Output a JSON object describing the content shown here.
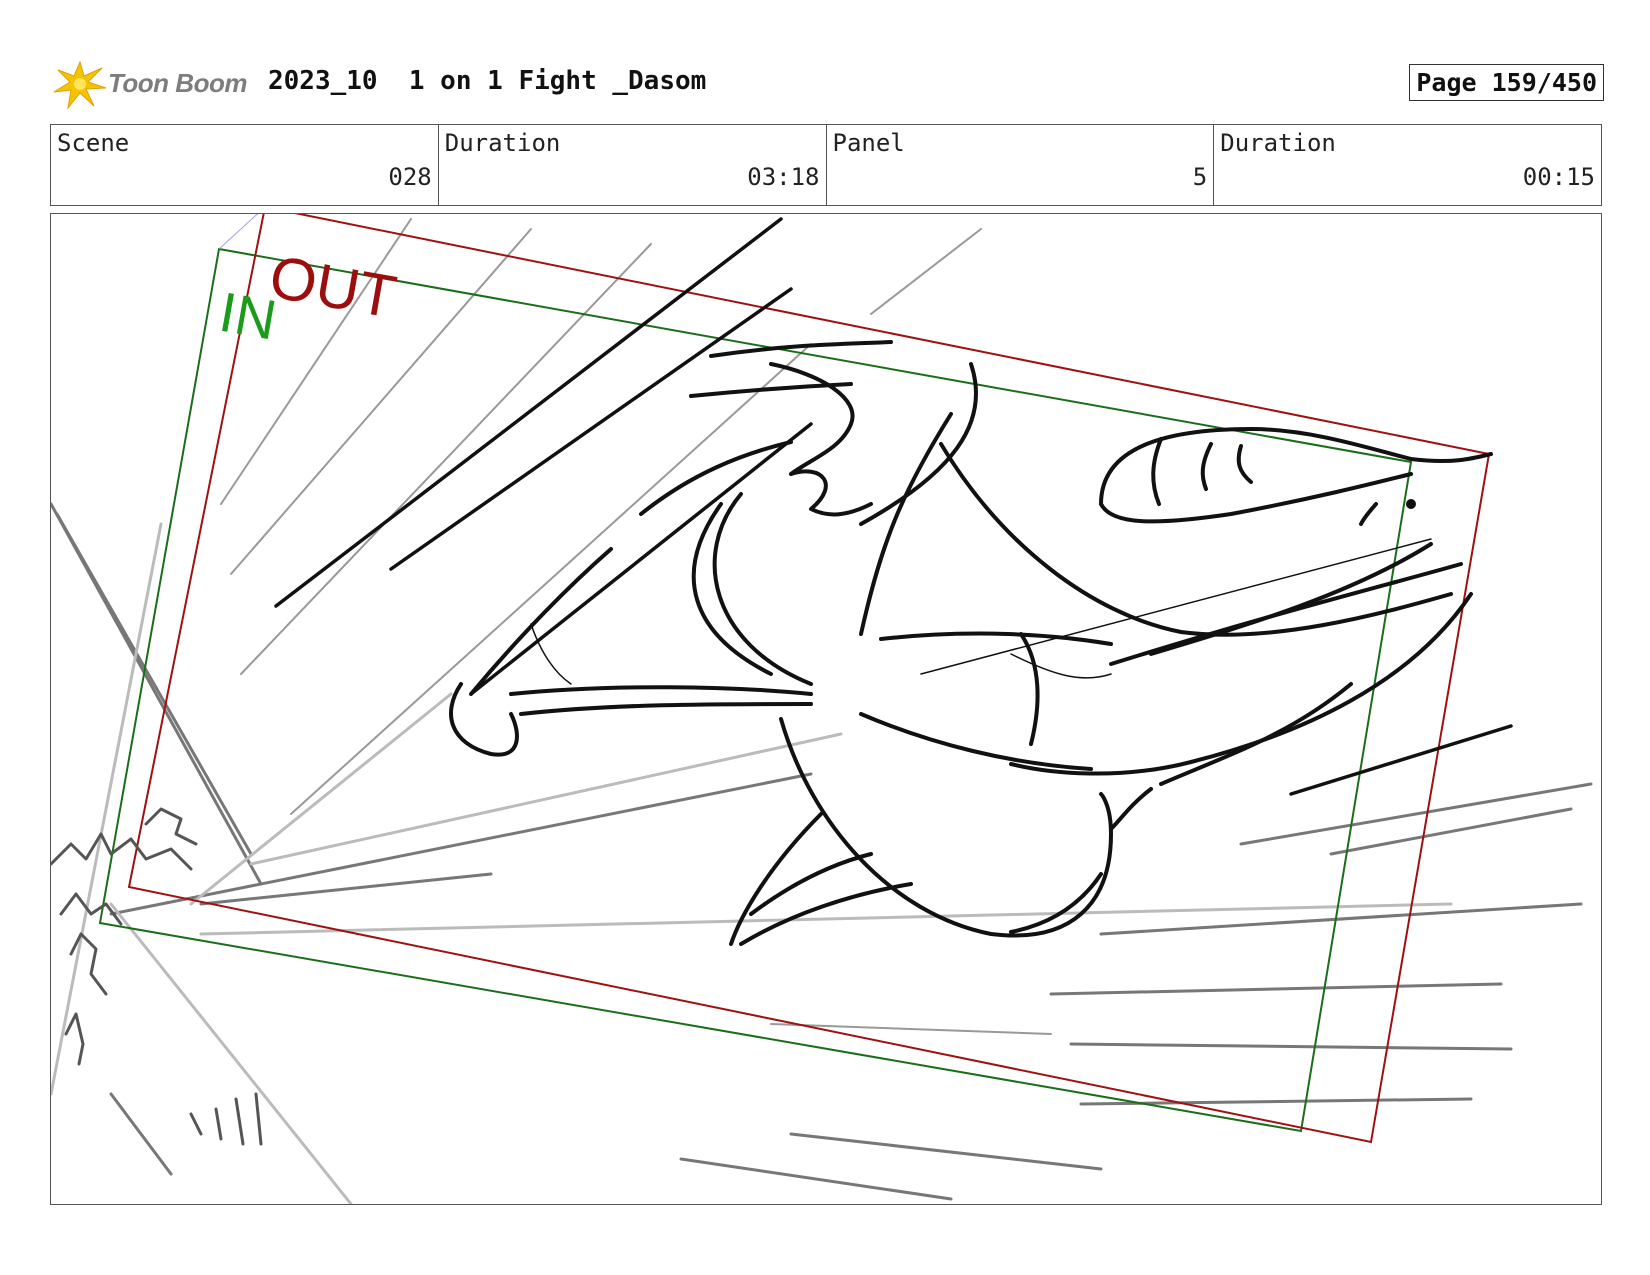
{
  "header": {
    "logo_text": "Toon Boom",
    "project_title": "2023_10  1 on 1 Fight _Dasom",
    "page_label": "Page 159/450"
  },
  "info": {
    "scene_label": "Scene",
    "scene_value": "028",
    "scene_duration_label": "Duration",
    "scene_duration_value": "03:18",
    "panel_label": "Panel",
    "panel_value": "5",
    "panel_duration_label": "Duration",
    "panel_duration_value": "00:15"
  },
  "frames": {
    "in_label": "IN",
    "out_label": "OUT",
    "in_color": "#1a8c1a",
    "out_color": "#a01010"
  }
}
